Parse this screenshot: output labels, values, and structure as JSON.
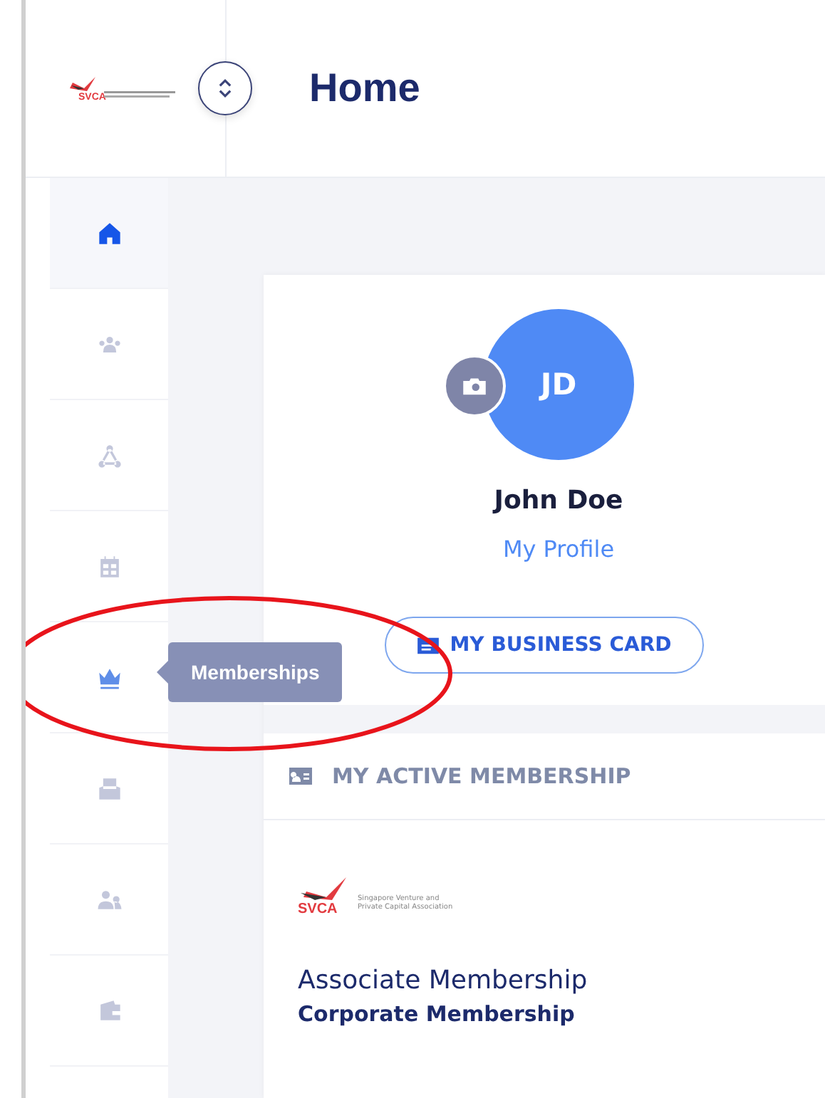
{
  "header": {
    "logo_text": "SVCA",
    "title": "Home"
  },
  "sidebar": {
    "items": [
      {
        "kind": "home",
        "selected": true,
        "hovered": false
      },
      {
        "kind": "group",
        "selected": false,
        "hovered": false
      },
      {
        "kind": "network",
        "selected": false,
        "hovered": false
      },
      {
        "kind": "calendar",
        "selected": false,
        "hovered": false
      },
      {
        "kind": "crown",
        "selected": false,
        "hovered": true
      },
      {
        "kind": "inbox",
        "selected": false,
        "hovered": false
      },
      {
        "kind": "people",
        "selected": false,
        "hovered": false
      },
      {
        "kind": "wallet",
        "selected": false,
        "hovered": false
      }
    ]
  },
  "tooltip": {
    "text": "Memberships"
  },
  "profile": {
    "initials": "JD",
    "name": "John Doe",
    "link": "My Profile",
    "button": "MY BUSINESS CARD"
  },
  "membership": {
    "heading": "MY ACTIVE MEMBERSHIP",
    "logo": {
      "abbr": "SVCA",
      "tagline": [
        "Singapore Venture and",
        "Private Capital Association"
      ]
    },
    "title": "Associate Membership",
    "subtitle": "Corporate Membership"
  },
  "annotation": {
    "kind": "ellipse"
  }
}
